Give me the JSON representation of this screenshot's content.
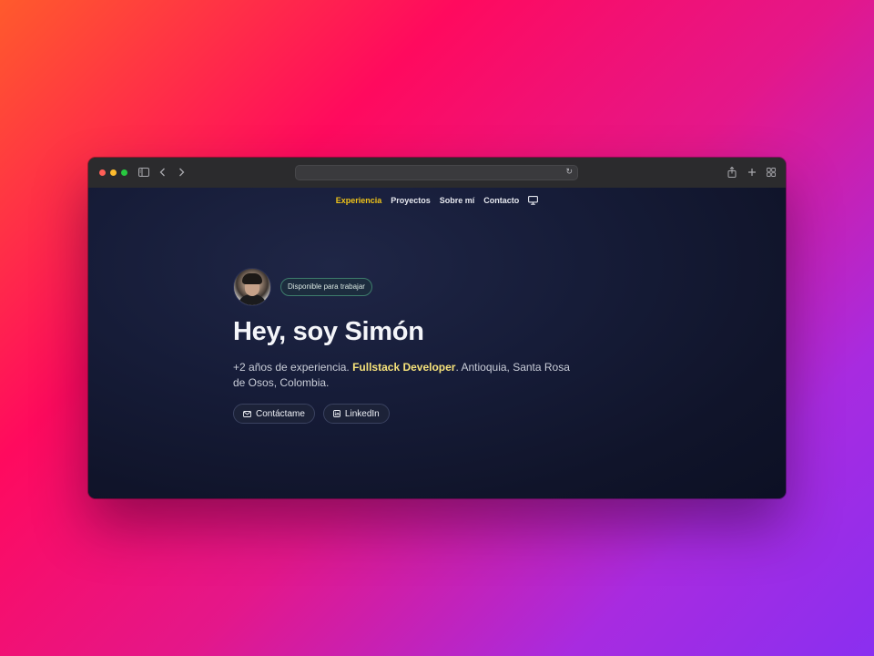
{
  "nav": {
    "items": [
      {
        "label": "Experiencia",
        "active": true
      },
      {
        "label": "Proyectos",
        "active": false
      },
      {
        "label": "Sobre mí",
        "active": false
      },
      {
        "label": "Contacto",
        "active": false
      }
    ],
    "theme_icon": "monitor-icon"
  },
  "hero": {
    "badge": "Disponible para trabajar",
    "title": "Hey, soy Simón",
    "desc_prefix": "+2 años de experiencia. ",
    "desc_highlight": "Fullstack Developer",
    "desc_suffix": ". Antioquia, Santa Rosa de Osos, Colombia.",
    "buttons": [
      {
        "label": "Contáctame",
        "icon": "mail-icon"
      },
      {
        "label": "LinkedIn",
        "icon": "linkedin-icon"
      }
    ]
  },
  "browser": {
    "address": "",
    "icons": [
      "sidebar-icon",
      "back-icon",
      "forward-icon",
      "reload-icon",
      "share-icon",
      "new-tab-icon",
      "tab-overview-icon"
    ]
  },
  "colors": {
    "accent": "#f0c419",
    "highlight": "#f6e27a",
    "badge_border": "#3e7d6c",
    "page_bg": "#10142a"
  }
}
